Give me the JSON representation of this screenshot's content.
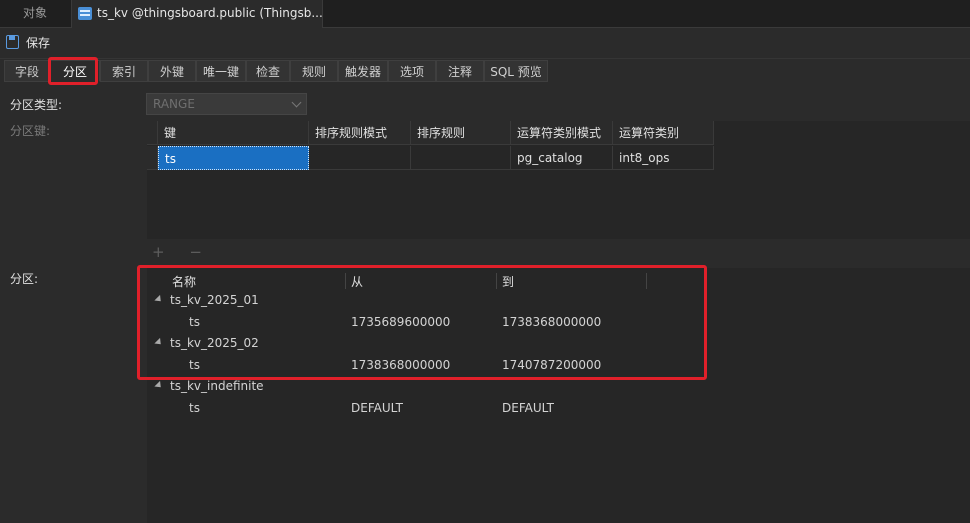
{
  "window_tabs": {
    "objects_tab": "对象",
    "doc_tab": "ts_kv @thingsboard.public (Thingsb..."
  },
  "toolbar": {
    "save_label": "保存"
  },
  "sub_tabs": [
    "字段",
    "分区",
    "索引",
    "外键",
    "唯一键",
    "检查",
    "规则",
    "触发器",
    "选项",
    "注释",
    "SQL 预览"
  ],
  "form": {
    "partition_type_label": "分区类型:",
    "partition_type_value": "RANGE",
    "partition_key_label": "分区键:",
    "partitions_label": "分区:"
  },
  "key_grid": {
    "headers": [
      "键",
      "排序规则模式",
      "排序规则",
      "运算符类别模式",
      "运算符类别"
    ],
    "rows": [
      [
        "ts",
        "",
        "",
        "pg_catalog",
        "int8_ops"
      ]
    ],
    "add_remove": "+ −"
  },
  "partitions": {
    "headers": [
      "名称",
      "从",
      "到"
    ],
    "items": [
      {
        "name": "ts_kv_2025_01",
        "column": "ts",
        "from": "1735689600000",
        "to": "1738368000000"
      },
      {
        "name": "ts_kv_2025_02",
        "column": "ts",
        "from": "1738368000000",
        "to": "1740787200000"
      },
      {
        "name": "ts_kv_indefinite",
        "column": "ts",
        "from": "DEFAULT",
        "to": "DEFAULT"
      }
    ]
  },
  "colors": {
    "highlight": "#e0202a",
    "selection": "#1a6fc2",
    "accent": "#4a8fd6"
  }
}
